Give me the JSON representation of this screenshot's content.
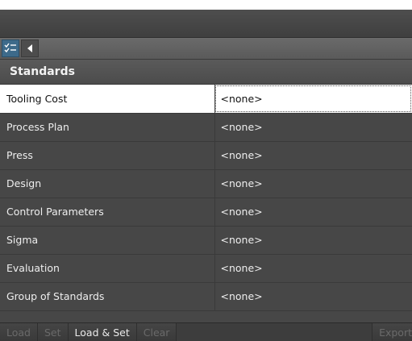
{
  "section": {
    "title": "Standards"
  },
  "toolbar": {
    "list_icon": "checklist-icon",
    "back_icon": "chevron-left-icon"
  },
  "rows": [
    {
      "name": "Tooling Cost",
      "value": "<none>"
    },
    {
      "name": "Process Plan",
      "value": "<none>"
    },
    {
      "name": "Press",
      "value": "<none>"
    },
    {
      "name": "Design",
      "value": "<none>"
    },
    {
      "name": "Control Parameters",
      "value": "<none>"
    },
    {
      "name": "Sigma",
      "value": "<none>"
    },
    {
      "name": "Evaluation",
      "value": "<none>"
    },
    {
      "name": "Group of Standards",
      "value": "<none>"
    }
  ],
  "bottom": {
    "load": "Load",
    "set": "Set",
    "load_set": "Load & Set",
    "clear": "Clear",
    "export": "Export"
  }
}
